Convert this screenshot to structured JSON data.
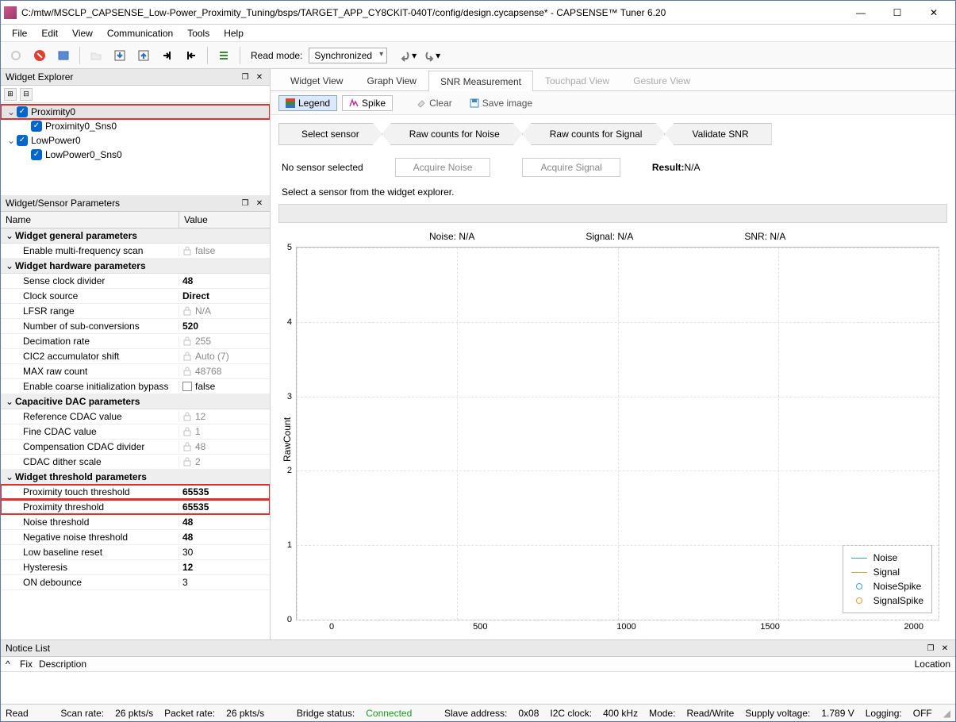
{
  "title": "C:/mtw/MSCLP_CAPSENSE_Low-Power_Proximity_Tuning/bsps/TARGET_APP_CY8CKIT-040T/config/design.cycapsense* - CAPSENSE™ Tuner 6.20",
  "menus": [
    "File",
    "Edit",
    "View",
    "Communication",
    "Tools",
    "Help"
  ],
  "readmode_label": "Read mode:",
  "readmode_value": "Synchronized",
  "left": {
    "explorer_title": "Widget Explorer",
    "tree": [
      {
        "label": "Proximity0",
        "indent": 0,
        "tw": "⌄",
        "sel": true,
        "hl": true
      },
      {
        "label": "Proximity0_Sns0",
        "indent": 1,
        "tw": ""
      },
      {
        "label": "LowPower0",
        "indent": 0,
        "tw": "⌄"
      },
      {
        "label": "LowPower0_Sns0",
        "indent": 1,
        "tw": ""
      }
    ],
    "params_title": "Widget/Sensor Parameters",
    "cols": {
      "name": "Name",
      "value": "Value"
    },
    "groups": [
      {
        "title": "Widget general parameters",
        "rows": [
          {
            "n": "Enable multi-frequency scan",
            "v": "false",
            "lock": true,
            "grey": true
          }
        ]
      },
      {
        "title": "Widget hardware parameters",
        "rows": [
          {
            "n": "Sense clock divider",
            "v": "48",
            "bold": true
          },
          {
            "n": "Clock source",
            "v": "Direct",
            "bold": true
          },
          {
            "n": "LFSR range",
            "v": "N/A",
            "lock": true,
            "grey": true
          },
          {
            "n": "Number of sub-conversions",
            "v": "520",
            "bold": true
          },
          {
            "n": "Decimation rate",
            "v": "255",
            "lock": true,
            "grey": true
          },
          {
            "n": "CIC2 accumulator shift",
            "v": "Auto (7)",
            "lock": true,
            "grey": true
          },
          {
            "n": "MAX raw count",
            "v": "48768",
            "lock": true,
            "grey": true
          },
          {
            "n": "Enable coarse initialization bypass",
            "v": "false",
            "chk": true
          }
        ]
      },
      {
        "title": "Capacitive DAC parameters",
        "rows": [
          {
            "n": "Reference CDAC value",
            "v": "12",
            "lock": true,
            "grey": true
          },
          {
            "n": "Fine CDAC value",
            "v": "1",
            "lock": true,
            "grey": true
          },
          {
            "n": "Compensation CDAC divider",
            "v": "48",
            "lock": true,
            "grey": true
          },
          {
            "n": "CDAC dither scale",
            "v": "2",
            "lock": true,
            "grey": true
          }
        ]
      },
      {
        "title": "Widget threshold parameters",
        "rows": [
          {
            "n": "Proximity touch threshold",
            "v": "65535",
            "bold": true,
            "red": true
          },
          {
            "n": "Proximity threshold",
            "v": "65535",
            "bold": true,
            "red": true
          },
          {
            "n": "Noise threshold",
            "v": "48",
            "bold": true
          },
          {
            "n": "Negative noise threshold",
            "v": "48",
            "bold": true
          },
          {
            "n": "Low baseline reset",
            "v": "30"
          },
          {
            "n": "Hysteresis",
            "v": "12",
            "bold": true
          },
          {
            "n": "ON debounce",
            "v": "3"
          }
        ]
      }
    ]
  },
  "tabs": [
    "Widget View",
    "Graph View",
    "SNR Measurement",
    "Touchpad View",
    "Gesture View"
  ],
  "active_tab": 2,
  "snr_toolbar": {
    "legend": "Legend",
    "spike": "Spike",
    "clear": "Clear",
    "save": "Save image"
  },
  "steps": [
    "Select sensor",
    "Raw counts for Noise",
    "Raw counts for Signal",
    "Validate SNR"
  ],
  "acq": {
    "none": "No sensor selected",
    "noise": "Acquire Noise",
    "signal": "Acquire Signal",
    "result_label": "Result:",
    "result_val": "N/A"
  },
  "msg": "Select a sensor from the widget explorer.",
  "stats": {
    "noise": "Noise:  N/A",
    "signal": "Signal:  N/A",
    "snr": "SNR:  N/A"
  },
  "chart_data": {
    "type": "line",
    "series": [
      {
        "name": "Noise",
        "values": []
      },
      {
        "name": "Signal",
        "values": []
      },
      {
        "name": "NoiseSpike",
        "values": []
      },
      {
        "name": "SignalSpike",
        "values": []
      }
    ],
    "xlim": [
      0,
      2000
    ],
    "ylim": [
      0,
      5
    ],
    "xticks": [
      0,
      500,
      1000,
      1500,
      2000
    ],
    "yticks": [
      0,
      1,
      2,
      3,
      4,
      5
    ],
    "ylabel": "RawCount",
    "legend": [
      "Noise",
      "Signal",
      "NoiseSpike",
      "SignalSpike"
    ]
  },
  "notice": {
    "title": "Notice List",
    "fix": "Fix",
    "desc": "Description",
    "loc": "Location"
  },
  "status": {
    "read": "Read",
    "scanrate_l": "Scan rate:",
    "scanrate_v": "26 pkts/s",
    "pktrate_l": "Packet rate:",
    "pktrate_v": "26 pkts/s",
    "bridge_l": "Bridge status:",
    "bridge_v": "Connected",
    "addr_l": "Slave address:",
    "addr_v": "0x08",
    "i2c_l": "I2C clock:",
    "i2c_v": "400 kHz",
    "mode_l": "Mode:",
    "mode_v": "Read/Write",
    "supply_l": "Supply voltage:",
    "supply_v": "1.789 V",
    "log_l": "Logging:",
    "log_v": "OFF"
  }
}
